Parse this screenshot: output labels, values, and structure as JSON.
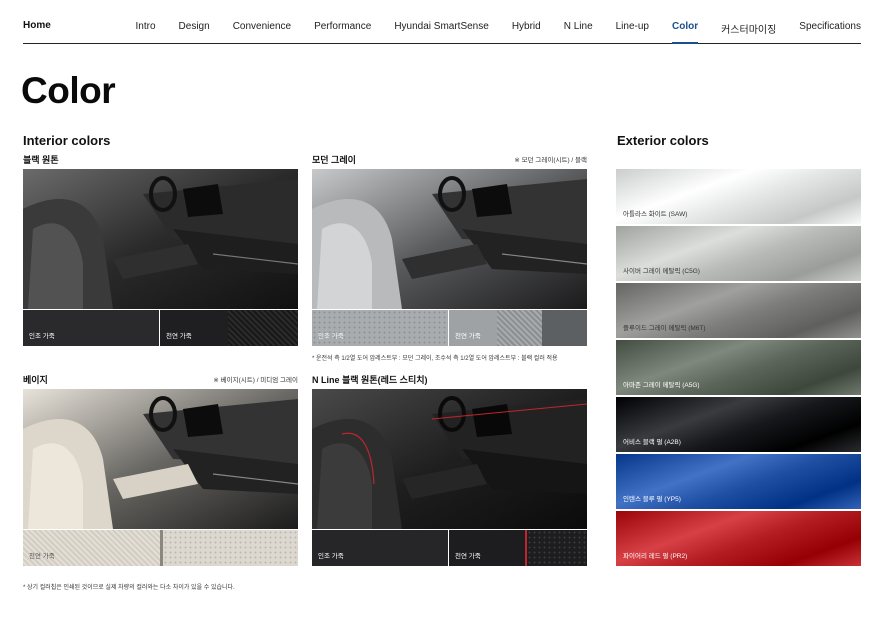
{
  "nav": {
    "home": "Home",
    "items": [
      "Intro",
      "Design",
      "Convenience",
      "Performance",
      "Hyundai SmartSense",
      "Hybrid",
      "N Line",
      "Line-up",
      "Color",
      "커스터마이징",
      "Specifications"
    ],
    "active": "Color"
  },
  "page_title": "Color",
  "interior": {
    "title": "Interior colors",
    "items": [
      {
        "name": "블랙 원톤",
        "note": "",
        "swatches": [
          {
            "label": "인조 가죽"
          },
          {
            "label": "천연 가죽"
          }
        ]
      },
      {
        "name": "모던 그레이",
        "note": "※ 모던 그레이(시트) / 블랙",
        "swatches": [
          {
            "label": "인조 가죽"
          },
          {
            "label": "천연 가죽"
          }
        ]
      },
      {
        "name": "베이지",
        "note": "※ 베이지(시트) / 미디엄 그레이",
        "swatches": [
          {
            "label": "천연 가죽"
          }
        ]
      },
      {
        "name": "N Line 블랙 원톤(레드 스티치)",
        "note": "",
        "swatches": [
          {
            "label": "인조 가죽"
          },
          {
            "label": "천연 가죽"
          }
        ]
      }
    ],
    "modern_gray_footnote": "* 운전석 측 1/2열 도어 암레스트부 : 모던 그레이, 조수석 측 1/2열 도어 암레스트부 : 블랙 컬러 적용",
    "bottom_note": "* 상기 컬러칩은 인쇄된 것이므로 실제 차량의 컬러와는 다소 차이가 있을 수 있습니다."
  },
  "exterior": {
    "title": "Exterior colors",
    "items": [
      {
        "label": "아틀라스 화이트 (SAW)",
        "color": "#e4e6e6"
      },
      {
        "label": "사이버 그레이 메탈릭 (C5G)",
        "color": "#b9bbb9"
      },
      {
        "label": "플루이드 그레이 메탈릭 (M6T)",
        "color": "#7d7e7c"
      },
      {
        "label": "아마존 그레이 메탈릭 (A5G)",
        "color": "#5c6559"
      },
      {
        "label": "어비스 블랙 펄 (A2B)",
        "color": "#16181c"
      },
      {
        "label": "인텐스 블루 펄 (YP5)",
        "color": "#1f4fa3"
      },
      {
        "label": "파이어리 레드 펄 (PR2)",
        "color": "#b41d22"
      }
    ]
  },
  "colors": {
    "accent": "#1b4f8a"
  }
}
